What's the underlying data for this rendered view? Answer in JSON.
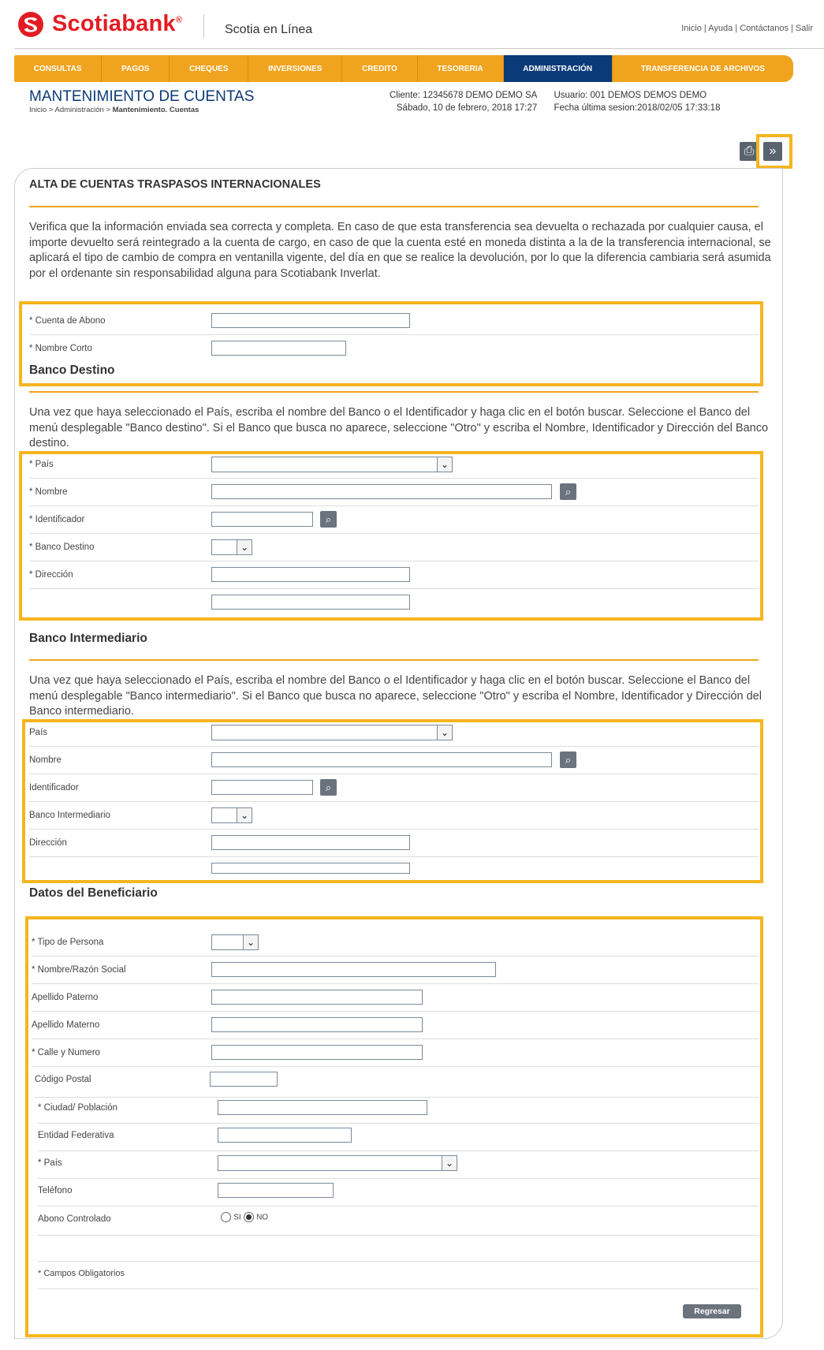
{
  "header": {
    "logo_text": "Scotiabank",
    "logo_reg": "®",
    "app_name": "Scotia en Línea",
    "links": [
      "Inicio",
      "Ayuda",
      "Contáctanos",
      "Salir"
    ]
  },
  "nav": {
    "items": [
      "CONSULTAS",
      "PAGOS",
      "CHEQUES",
      "INVERSIONES",
      "CREDITO",
      "TESORERIA",
      "ADMINISTRACIÓN",
      "TRANSFERENCIA DE ARCHIVOS"
    ],
    "active": "ADMINISTRACIÓN"
  },
  "page": {
    "title": "MANTENIMIENTO DE CUENTAS",
    "breadcrumb_prefix": "Inicio > Administración > ",
    "breadcrumb_current": "Mantenimiento. Cuentas",
    "client": "Cliente: 12345678 DEMO DEMO SA",
    "date": "Sábado, 10 de febrero, 2018 17:27",
    "user": "Usuario: 001 DEMOS DEMOS DEMO",
    "last_session": "Fecha última sesion:2018/02/05 17:33:18"
  },
  "tools": {
    "print_icon": "print-icon",
    "next_icon": "double-chevron-right-icon"
  },
  "form": {
    "section_title": "ALTA DE CUENTAS TRASPASOS INTERNACIONALES",
    "intro": "Verifica que la información enviada sea correcta y completa. En caso de que esta transferencia sea devuelta o rechazada por cualquier causa, el importe devuelto será reintegrado a la cuenta de cargo, en caso de que la cuenta esté en moneda distinta a la de la transferencia internacional, se aplicará el tipo de cambio de compra en ventanilla vigente, del día en que se realice la devolución, por lo que la diferencia cambiaria será asumida por el ordenante sin responsabilidad alguna para Scotiabank Inverlat.",
    "account_labels": {
      "cuenta_abono": "* Cuenta de Abono",
      "nombre_corto": "* Nombre Corto"
    },
    "banco_destino": {
      "heading": "Banco Destino",
      "instructions": "Una vez que haya seleccionado el País, escriba el nombre del Banco o el Identificador y haga clic en el botón buscar. Seleccione el Banco del menú desplegable \"Banco destino\". Si el Banco que busca no aparece, seleccione \"Otro\" y escriba el Nombre, Identificador y Dirección del Banco destino.",
      "pais": "* País",
      "nombre": "* Nombre",
      "identificador": "* Identificador",
      "banco": "* Banco Destino",
      "direccion": "* Dirección"
    },
    "banco_intermediario": {
      "heading": "Banco Intermediario",
      "instructions": "Una vez que haya seleccionado el País, escriba el nombre del Banco o el Identificador y haga clic en el botón buscar. Seleccione el Banco del menú desplegable \"Banco intermediario\". Si el Banco que busca no aparece, seleccione \"Otro\" y escriba el Nombre, Identificador y Dirección del Banco intermediario.",
      "pais": "País",
      "nombre": "Nombre",
      "identificador": "Identificador",
      "banco": "Banco Intermediario",
      "direccion": "Dirección"
    },
    "beneficiario": {
      "heading": "Datos del Beneficiario",
      "tipo_persona": "* Tipo de Persona",
      "nombre_razon": "* Nombre/Razón Social",
      "apellido_paterno": "Apellido Paterno",
      "apellido_materno": "Apellido Materno",
      "calle_numero": "* Calle y Numero",
      "codigo_postal": "Código Postal",
      "ciudad": "* Ciudad/ Población",
      "entidad": "Entidad Federativa",
      "pais": "* País",
      "telefono": "Teléfono",
      "abono_controlado": "Abono Controlado",
      "si": "SI",
      "no": "NO",
      "abono_value": "NO"
    },
    "required_note": "* Campos Obligatorios",
    "back_button": "Regresar"
  },
  "colors": {
    "brand_red": "#e31c23",
    "nav_orange": "#f0a31e",
    "nav_active": "#0b3a78",
    "highlight": "#f5b51e"
  }
}
